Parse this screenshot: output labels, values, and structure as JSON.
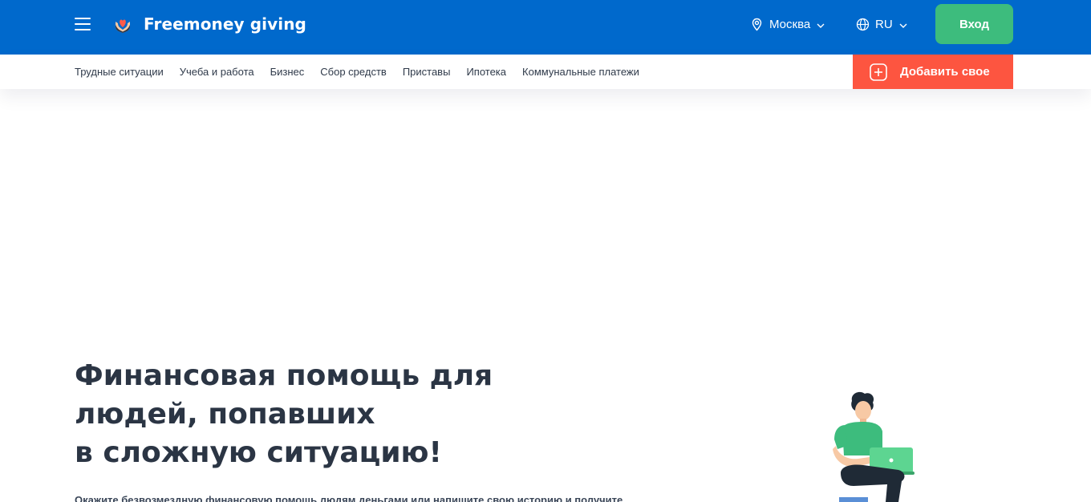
{
  "header": {
    "menu_icon": "hamburger-icon",
    "logo": {
      "icon": "heart-hands-icon",
      "text": "Freemoney giving"
    },
    "city": {
      "icon": "map-pin-icon",
      "label": "Москва"
    },
    "language": {
      "icon": "globe-icon",
      "label": "RU"
    },
    "login_label": "Вход"
  },
  "nav": {
    "items": [
      "Трудные ситуации",
      "Учеба и работа",
      "Бизнес",
      "Сбор средств",
      "Приставы",
      "Ипотека",
      "Коммунальные платежи"
    ],
    "add_button": {
      "icon": "plus-square-icon",
      "label": "Добавить свое"
    }
  },
  "hero": {
    "title_lines": [
      "Финансовая помощь для",
      "людей, попавших",
      "в сложную ситуацию!"
    ],
    "description": "Окажите безвозмездную финансовую помощь людям деньгами или напишите свою историю и получите"
  },
  "colors": {
    "header_bg": "#0069cc",
    "login_button": "#3dbc7d",
    "add_button": "#fd5540",
    "title_text": "#2b3544"
  }
}
